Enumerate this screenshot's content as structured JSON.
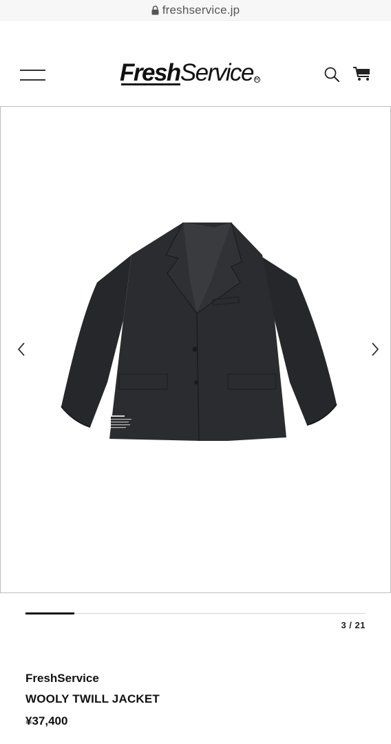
{
  "browser": {
    "url": "freshservice.jp"
  },
  "header": {
    "logo_primary": "Fresh",
    "logo_secondary": "Service",
    "logo_mark": "R",
    "menu_icon": "hamburger-menu-icon",
    "search_icon": "search-icon",
    "cart_icon": "cart-icon"
  },
  "gallery": {
    "prev_icon": "chevron-left-icon",
    "next_icon": "chevron-right-icon",
    "current": 3,
    "total": 21,
    "counter_text": "3 / 21",
    "progress": 0.143
  },
  "product": {
    "brand": "FreshService",
    "name": "WOOLY TWILL JACKET",
    "price": "¥37,400"
  },
  "colors": {
    "accent": "#111111",
    "border": "#bdbdbd",
    "jacket": "#2a2b2d"
  }
}
